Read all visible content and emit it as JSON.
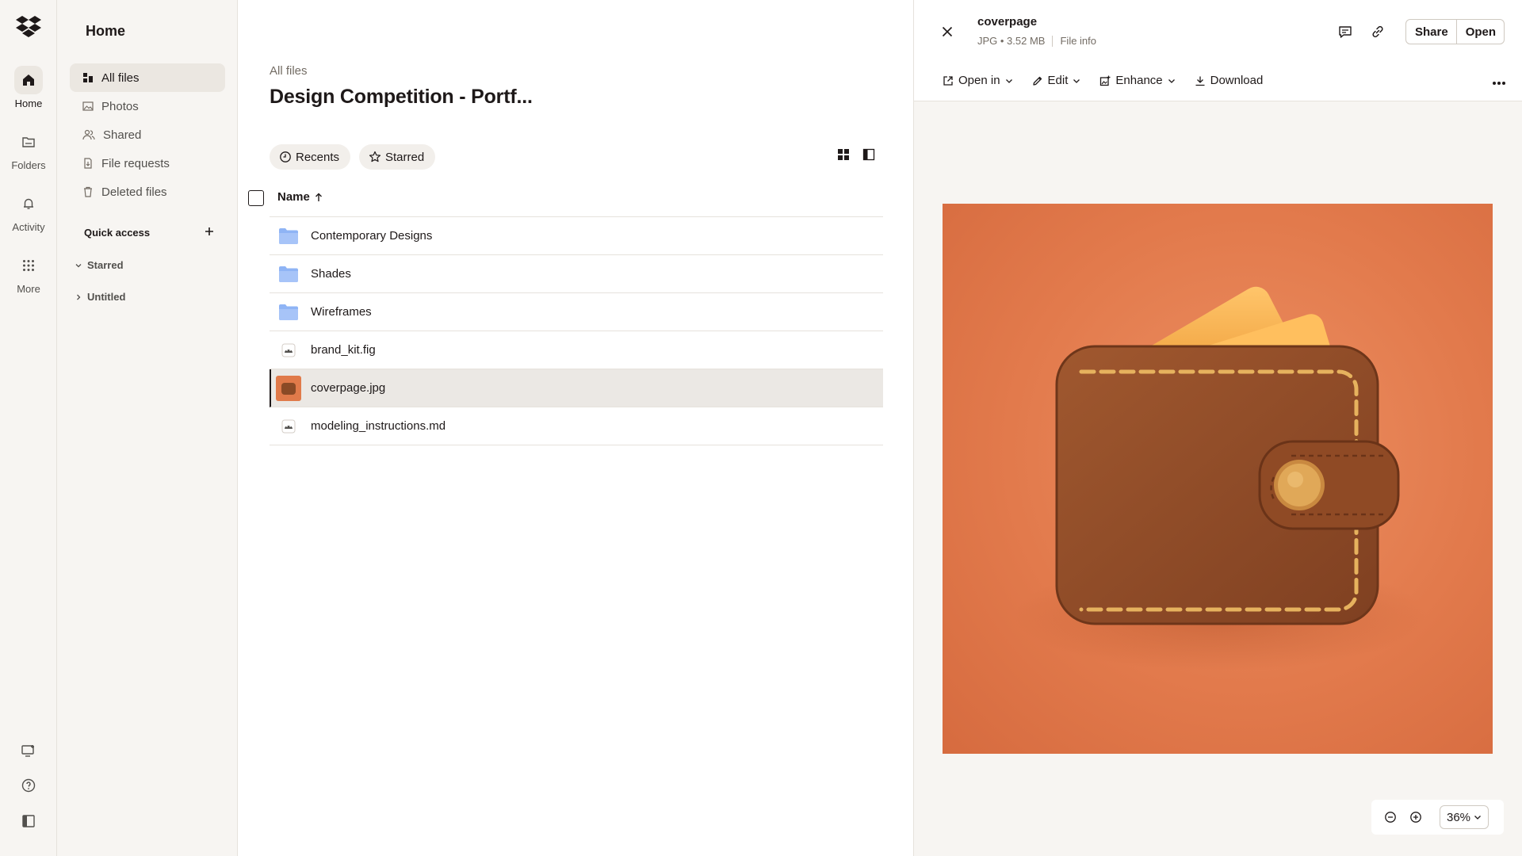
{
  "rail": {
    "items": [
      {
        "label": "Home",
        "icon": "home-icon"
      },
      {
        "label": "Folders",
        "icon": "folder-icon"
      },
      {
        "label": "Activity",
        "icon": "bell-icon"
      },
      {
        "label": "More",
        "icon": "grid-icon"
      }
    ]
  },
  "sidebar": {
    "title": "Home",
    "items": [
      {
        "label": "All files",
        "icon": "all-files-icon"
      },
      {
        "label": "Photos",
        "icon": "photo-icon"
      },
      {
        "label": "Shared",
        "icon": "shared-icon"
      },
      {
        "label": "File requests",
        "icon": "file-request-icon"
      },
      {
        "label": "Deleted files",
        "icon": "trash-icon"
      }
    ],
    "quick_access": {
      "title": "Quick access",
      "groups": [
        "Starred",
        "Untitled"
      ]
    }
  },
  "main": {
    "breadcrumb": "All files",
    "title": "Design Competition - Portf...",
    "chips": [
      "Recents",
      "Starred"
    ],
    "column_name": "Name",
    "rows": [
      {
        "name": "Contemporary Designs",
        "type": "folder"
      },
      {
        "name": "Shades",
        "type": "folder"
      },
      {
        "name": "Wireframes",
        "type": "folder"
      },
      {
        "name": "brand_kit.fig",
        "type": "file"
      },
      {
        "name": "coverpage.jpg",
        "type": "image"
      },
      {
        "name": "modeling_instructions.md",
        "type": "file"
      }
    ]
  },
  "preview": {
    "file_name": "coverpage",
    "meta": "JPG • 3.52 MB",
    "file_info": "File info",
    "share_label": "Share",
    "open_label": "Open",
    "toolbar": [
      "Open in",
      "Edit",
      "Enhance",
      "Download"
    ],
    "zoom": "36%"
  },
  "colors": {
    "accent_folder": "#8fb4f5",
    "image_background": "#e27a4c",
    "wallet": "#8a4a26",
    "selection": "#ebe8e4"
  }
}
